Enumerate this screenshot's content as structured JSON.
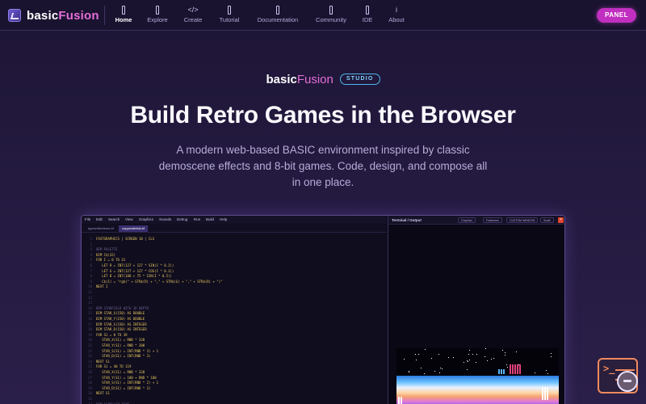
{
  "brand": {
    "name_main": "basic",
    "name_accent": "Fusion"
  },
  "nav": {
    "items": [
      {
        "id": "home",
        "label": "Home",
        "icon": "bar-icon",
        "glyph": "",
        "active": true
      },
      {
        "id": "explore",
        "label": "Explore",
        "icon": "bar-icon",
        "glyph": "",
        "active": false
      },
      {
        "id": "create",
        "label": "Create",
        "icon": "code-icon",
        "glyph": "</>",
        "active": false
      },
      {
        "id": "tutorial",
        "label": "Tutorial",
        "icon": "bar-icon",
        "glyph": "",
        "active": false
      },
      {
        "id": "documentation",
        "label": "Documentation",
        "icon": "bar-icon",
        "glyph": "",
        "active": false
      },
      {
        "id": "community",
        "label": "Community",
        "icon": "bar-icon",
        "glyph": "",
        "active": false
      },
      {
        "id": "ide",
        "label": "IDE",
        "icon": "bar-icon",
        "glyph": "",
        "active": false
      },
      {
        "id": "about",
        "label": "About",
        "icon": "info-icon",
        "glyph": "i",
        "active": false
      }
    ],
    "panel_button": "PANEL"
  },
  "hero": {
    "logo_main": "basic",
    "logo_accent": "Fusion",
    "badge": "STUDIO",
    "title": "Build Retro Games in the Browser",
    "subtitle": "A modern web-based BASIC environment inspired by classic demoscene effects and 8-bit games. Code, design, and compose all in one place."
  },
  "ide_preview": {
    "menus": [
      "File",
      "Edit",
      "Search",
      "View",
      "Graphics",
      "Sounds",
      "Debug",
      "Run",
      "Build",
      "Help"
    ],
    "tabs": [
      {
        "label": "typewriterdemo.bf",
        "active": false
      },
      {
        "label": "coppersfields.bf",
        "active": true
      }
    ],
    "code": [
      {
        "n": "1",
        "text": "FASTGRAPHICS | SCREEN 10 | CLS",
        "kind": "c"
      },
      {
        "n": "2",
        "text": "",
        "kind": "c"
      },
      {
        "n": "3",
        "text": "REM PALETTE",
        "kind": "cm"
      },
      {
        "n": "4",
        "text": "DIM C$(32)",
        "kind": "c"
      },
      {
        "n": "5",
        "text": "FOR I = 0 TO 31",
        "kind": "c"
      },
      {
        "n": "6",
        "text": "   LET R = INT(127 + 127 * SIN(I * 0.2))",
        "kind": "c"
      },
      {
        "n": "7",
        "text": "   LET G = INT(127 + 127 * COS(I * 0.3))",
        "kind": "c"
      },
      {
        "n": "8",
        "text": "   LET B = INT(180 + 75 * SIN(I * 0.5))",
        "kind": "c"
      },
      {
        "n": "9",
        "text": "   C$(I) = \"rgb(\" + STR$(R) + \",\" + STR$(G) + \",\" + STR$(B) + \")\"",
        "kind": "c"
      },
      {
        "n": "10",
        "text": "NEXT I",
        "kind": "c"
      },
      {
        "n": "11",
        "text": "",
        "kind": "c"
      },
      {
        "n": "12",
        "text": "",
        "kind": "c"
      },
      {
        "n": "13",
        "text": "",
        "kind": "c"
      },
      {
        "n": "14",
        "text": "REM STARFIELD WITH 3D DEPTH",
        "kind": "cm"
      },
      {
        "n": "15",
        "text": "DIM STAR_X(150) AS DOUBLE",
        "kind": "c"
      },
      {
        "n": "16",
        "text": "DIM STAR_Y(150) AS DOUBLE",
        "kind": "c"
      },
      {
        "n": "17",
        "text": "DIM STAR_S(150) AS INTEGER",
        "kind": "c"
      },
      {
        "n": "18",
        "text": "DIM STAR_D(150) AS INTEGER",
        "kind": "c"
      },
      {
        "n": "19",
        "text": "FOR S1 = 0 TO 39",
        "kind": "c"
      },
      {
        "n": "20",
        "text": "   STAR_X(S1) = RND * 320",
        "kind": "c"
      },
      {
        "n": "21",
        "text": "   STAR_Y(S1) = RND * 200",
        "kind": "c"
      },
      {
        "n": "22",
        "text": "   STAR_S(S1) = INT(RND * 3) + 1",
        "kind": "c"
      },
      {
        "n": "23",
        "text": "   STAR_D(S1) = INT(RND * 3)",
        "kind": "c"
      },
      {
        "n": "24",
        "text": "NEXT S1",
        "kind": "c"
      },
      {
        "n": "25",
        "text": "FOR S1 = 40 TO 119",
        "kind": "c"
      },
      {
        "n": "26",
        "text": "   STAR_X(S1) = RND * 320",
        "kind": "c"
      },
      {
        "n": "27",
        "text": "   STAR_Y(S1) = 100 + RND * 100",
        "kind": "c"
      },
      {
        "n": "28",
        "text": "   STAR_S(S1) = INT(RND * 2) + 1",
        "kind": "c"
      },
      {
        "n": "29",
        "text": "   STAR_D(S1) = INT(RND * 3)",
        "kind": "c"
      },
      {
        "n": "30",
        "text": "NEXT S1",
        "kind": "c"
      },
      {
        "n": "31",
        "text": "",
        "kind": "c"
      },
      {
        "n": "32",
        "text": "REM SCROLLER TEXT",
        "kind": "cm"
      }
    ],
    "terminal": {
      "title": "Terminal / Output",
      "buttons": [
        "Graphics",
        "Fullscreen",
        "CUSTOM WINDOW",
        "Scale"
      ]
    }
  },
  "icons": {
    "brand": "basic-fusion-logo-icon",
    "assistant": "terminal-chat-icon"
  },
  "colors": {
    "accent_pink": "#c12fc0",
    "accent_cyan": "#4fb8e8",
    "code_yellow": "#e9c95f",
    "assistant_orange": "#f08a5d"
  }
}
